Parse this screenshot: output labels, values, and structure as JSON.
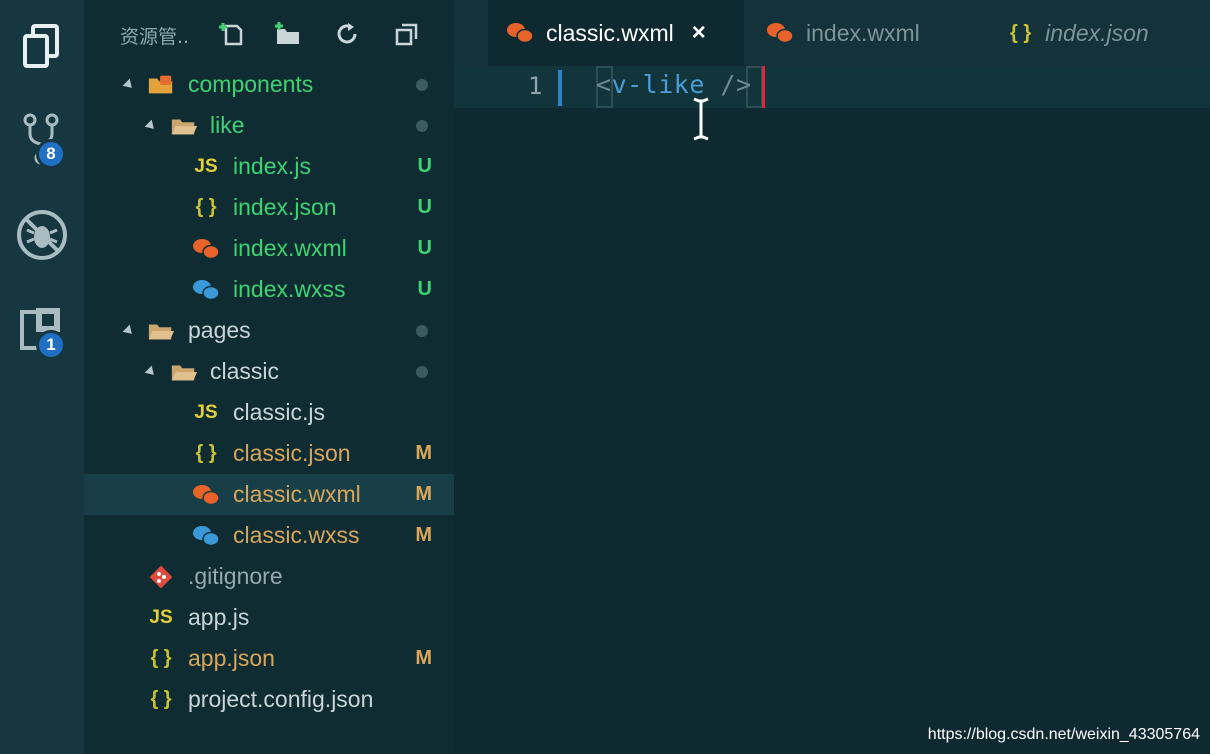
{
  "activity_bar": {
    "source_control_badge": "8",
    "extensions_badge": "1"
  },
  "sidebar": {
    "title": "资源管..",
    "tree": [
      {
        "name": "components",
        "kind": "folder",
        "status": "",
        "dot": true
      },
      {
        "name": "like",
        "kind": "folder",
        "status": "",
        "dot": true
      },
      {
        "name": "index.js",
        "kind": "js",
        "status": "U"
      },
      {
        "name": "index.json",
        "kind": "json",
        "status": "U"
      },
      {
        "name": "index.wxml",
        "kind": "wxml",
        "status": "U"
      },
      {
        "name": "index.wxss",
        "kind": "wxss",
        "status": "U"
      },
      {
        "name": "pages",
        "kind": "folder",
        "status": "",
        "dot": true
      },
      {
        "name": "classic",
        "kind": "folder",
        "status": "",
        "dot": true
      },
      {
        "name": "classic.js",
        "kind": "js",
        "status": ""
      },
      {
        "name": "classic.json",
        "kind": "json",
        "status": "M"
      },
      {
        "name": "classic.wxml",
        "kind": "wxml",
        "status": "M"
      },
      {
        "name": "classic.wxss",
        "kind": "wxss",
        "status": "M"
      },
      {
        "name": ".gitignore",
        "kind": "git",
        "status": ""
      },
      {
        "name": "app.js",
        "kind": "js",
        "status": ""
      },
      {
        "name": "app.json",
        "kind": "json",
        "status": "M"
      },
      {
        "name": "project.config.json",
        "kind": "json",
        "status": ""
      }
    ]
  },
  "editor": {
    "tabs": [
      {
        "label": "classic.wxml",
        "active": true
      },
      {
        "label": "index.wxml",
        "active": false
      },
      {
        "label": "index.json",
        "active": false
      }
    ],
    "line_number": "1",
    "code": {
      "open": "<",
      "tag": "v-like",
      "close": " />"
    }
  },
  "icons": {
    "js_glyph": "JS",
    "json_glyph": "{ }"
  },
  "watermark": "https://blog.csdn.net/weixin_43305764",
  "colors": {
    "untracked": "#3fd273",
    "modified": "#d9a65b",
    "accent": "#1f6fc4"
  }
}
